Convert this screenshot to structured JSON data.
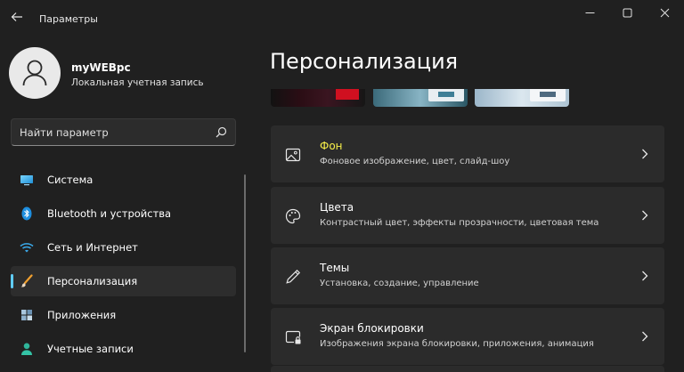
{
  "window": {
    "title": "Параметры"
  },
  "profile": {
    "name": "myWEBpc",
    "account_type": "Локальная учетная запись"
  },
  "search": {
    "placeholder": "Найти параметр"
  },
  "sidebar": {
    "items": [
      {
        "label": "Система",
        "icon": "monitor-icon",
        "active": false
      },
      {
        "label": "Bluetooth и устройства",
        "icon": "bluetooth-icon",
        "active": false
      },
      {
        "label": "Сеть и Интернет",
        "icon": "wifi-icon",
        "active": false
      },
      {
        "label": "Персонализация",
        "icon": "brush-icon",
        "active": true
      },
      {
        "label": "Приложения",
        "icon": "apps-icon",
        "active": false
      },
      {
        "label": "Учетные записи",
        "icon": "person-icon",
        "active": false
      }
    ]
  },
  "main": {
    "title": "Персонализация",
    "cards": [
      {
        "title": "Фон",
        "description": "Фоновое изображение, цвет, слайд-шоу",
        "icon": "image-icon"
      },
      {
        "title": "Цвета",
        "description": "Контрастный цвет, эффекты прозрачности, цветовая тема",
        "icon": "palette-icon"
      },
      {
        "title": "Темы",
        "description": "Установка, создание, управление",
        "icon": "pen-icon"
      },
      {
        "title": "Экран блокировки",
        "description": "Изображения экрана блокировки, приложения, анимация",
        "icon": "lock-screen-icon"
      }
    ]
  },
  "colors": {
    "accent": "#60cdff",
    "highlight": "#f7ef4a",
    "background": "#202020",
    "card": "#2b2b2b"
  }
}
